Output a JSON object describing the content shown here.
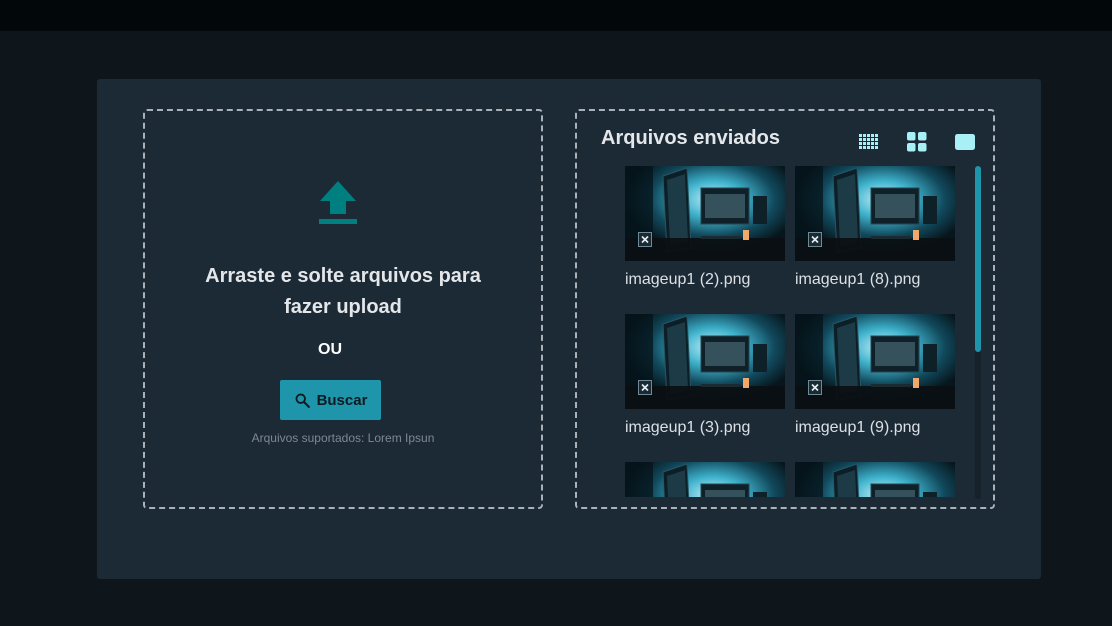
{
  "dropzone": {
    "icon": "upload-icon",
    "title": "Arraste e solte arquivos para fazer upload",
    "or_text": "OU",
    "button_label": "Buscar",
    "button_icon": "search-icon",
    "hint": "Arquivos suportados: Lorem Ipsun"
  },
  "uploaded": {
    "title": "Arquivos enviados",
    "view_modes": [
      "small-grid-icon",
      "medium-grid-icon",
      "large-view-icon"
    ],
    "files": [
      {
        "name": "imageup1 (2).png"
      },
      {
        "name": "imageup1 (8).png"
      },
      {
        "name": "imageup1 (3).png"
      },
      {
        "name": "imageup1 (9).png"
      },
      {
        "name": ""
      },
      {
        "name": ""
      }
    ]
  },
  "colors": {
    "accent": "#1e95aa",
    "icon_accent": "#007f80",
    "view_icon": "#a8f0f5",
    "panel": "#1c2a36",
    "background": "#0e151b"
  }
}
